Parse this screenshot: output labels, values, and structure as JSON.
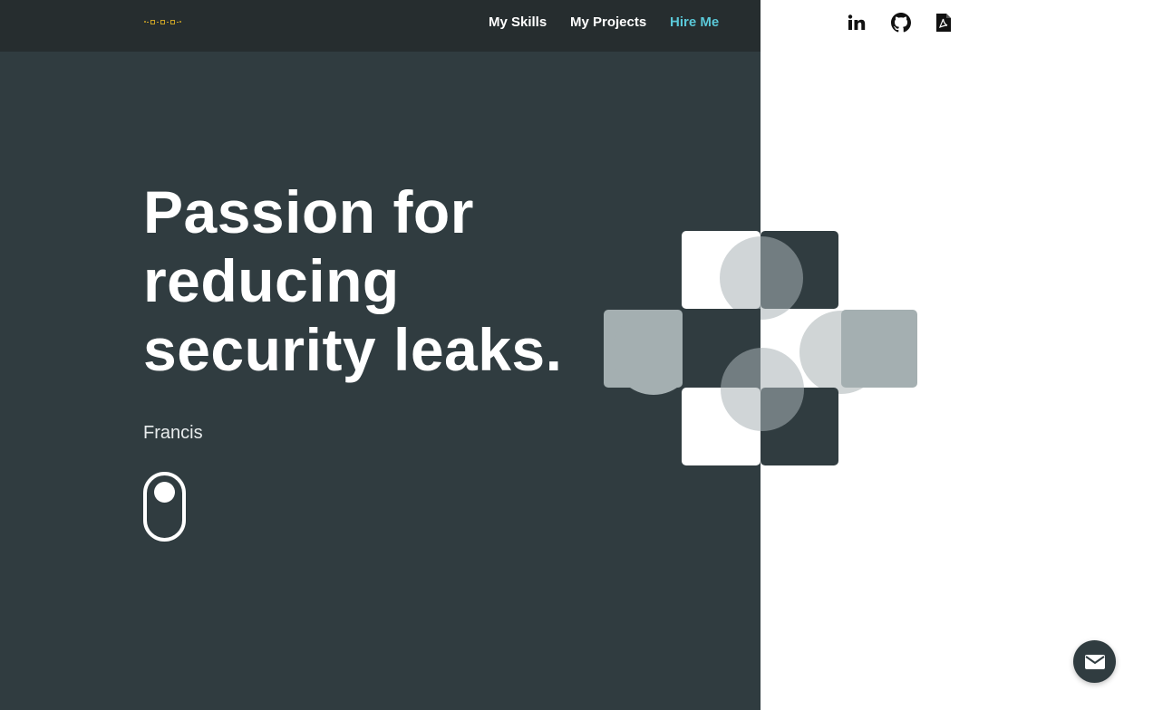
{
  "nav": {
    "logo_alt": "logo",
    "skills_label": "My Skills",
    "projects_label": "My Projects",
    "hire_label": "Hire Me"
  },
  "social": {
    "linkedin_icon": "linkedin-icon",
    "github_icon": "github-icon",
    "pdf_icon": "pdf-icon"
  },
  "hero": {
    "line1": "Passion for",
    "line2": "reducing",
    "line3": "security leaks.",
    "name": "Francis"
  },
  "contact": {
    "icon": "envelope-icon"
  },
  "colors": {
    "dark_panel": "#303c40",
    "navbar": "#262d2f",
    "accent": "#5ac8d8",
    "white": "#ffffff"
  }
}
